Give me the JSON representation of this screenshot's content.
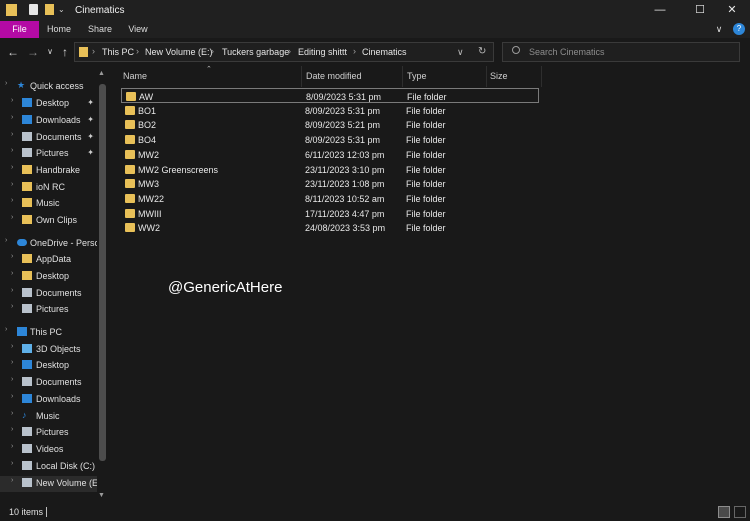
{
  "window": {
    "title": "Cinematics",
    "minimize": "—",
    "maximize": "☐",
    "close": "✕"
  },
  "ribbon": {
    "tabs": [
      "File",
      "Home",
      "Share",
      "View"
    ],
    "expand": "∨",
    "help": "?"
  },
  "nav": {
    "back": "←",
    "forward": "→",
    "recent": "∨",
    "up": "↑",
    "refresh": "↻",
    "breadcrumbs": [
      "This PC",
      "New Volume (E:)",
      "Tuckers garbage",
      "Editing shittt",
      "Cinematics"
    ],
    "dropdown": "∨",
    "search_placeholder": "Search Cinematics"
  },
  "navpane": {
    "items": [
      {
        "label": "Quick access",
        "icon": "star-icon",
        "level": 0,
        "pinned": false
      },
      {
        "label": "Desktop",
        "icon": "desktop-icon",
        "level": 1,
        "pinned": true
      },
      {
        "label": "Downloads",
        "icon": "downloads-icon",
        "level": 1,
        "pinned": true
      },
      {
        "label": "Documents",
        "icon": "documents-icon",
        "level": 1,
        "pinned": true
      },
      {
        "label": "Pictures",
        "icon": "pictures-icon",
        "level": 1,
        "pinned": true
      },
      {
        "label": "Handbrake",
        "icon": "folder-icon",
        "level": 1,
        "pinned": false
      },
      {
        "label": "ioN RC",
        "icon": "folder-icon",
        "level": 1,
        "pinned": false
      },
      {
        "label": "Music",
        "icon": "folder-icon",
        "level": 1,
        "pinned": false
      },
      {
        "label": "Own Clips",
        "icon": "folder-icon",
        "level": 1,
        "pinned": false
      },
      {
        "label": "OneDrive - Persor",
        "icon": "cloud-icon",
        "level": 0,
        "pinned": false
      },
      {
        "label": "AppData",
        "icon": "folder-icon",
        "level": 1,
        "pinned": false
      },
      {
        "label": "Desktop",
        "icon": "folder-icon",
        "level": 1,
        "pinned": false
      },
      {
        "label": "Documents",
        "icon": "documents-icon",
        "level": 1,
        "pinned": false
      },
      {
        "label": "Pictures",
        "icon": "pictures-icon",
        "level": 1,
        "pinned": false
      },
      {
        "label": "This PC",
        "icon": "pc-icon",
        "level": 0,
        "pinned": false
      },
      {
        "label": "3D Objects",
        "icon": "cube-icon",
        "level": 1,
        "pinned": false
      },
      {
        "label": "Desktop",
        "icon": "desktop-icon",
        "level": 1,
        "pinned": false
      },
      {
        "label": "Documents",
        "icon": "documents-icon",
        "level": 1,
        "pinned": false
      },
      {
        "label": "Downloads",
        "icon": "downloads-icon",
        "level": 1,
        "pinned": false
      },
      {
        "label": "Music",
        "icon": "music-icon",
        "level": 1,
        "pinned": false
      },
      {
        "label": "Pictures",
        "icon": "pictures-icon",
        "level": 1,
        "pinned": false
      },
      {
        "label": "Videos",
        "icon": "videos-icon",
        "level": 1,
        "pinned": false
      },
      {
        "label": "Local Disk (C:)",
        "icon": "drive-icon",
        "level": 1,
        "pinned": false
      },
      {
        "label": "New Volume (E:)",
        "icon": "drive-icon",
        "level": 1,
        "pinned": false
      }
    ]
  },
  "columns": {
    "name": "Name",
    "date": "Date modified",
    "type": "Type",
    "size": "Size"
  },
  "files": [
    {
      "name": "AW",
      "date": "8/09/2023 5:31 pm",
      "type": "File folder"
    },
    {
      "name": "BO1",
      "date": "8/09/2023 5:31 pm",
      "type": "File folder"
    },
    {
      "name": "BO2",
      "date": "8/09/2023 5:21 pm",
      "type": "File folder"
    },
    {
      "name": "BO4",
      "date": "8/09/2023 5:31 pm",
      "type": "File folder"
    },
    {
      "name": "MW2",
      "date": "6/11/2023 12:03 pm",
      "type": "File folder"
    },
    {
      "name": "MW2 Greenscreens",
      "date": "23/11/2023 3:10 pm",
      "type": "File folder"
    },
    {
      "name": "MW3",
      "date": "23/11/2023 1:08 pm",
      "type": "File folder"
    },
    {
      "name": "MW22",
      "date": "8/11/2023 10:52 am",
      "type": "File folder"
    },
    {
      "name": "MWIII",
      "date": "17/11/2023 4:47 pm",
      "type": "File folder"
    },
    {
      "name": "WW2",
      "date": "24/08/2023 3:53 pm",
      "type": "File folder"
    }
  ],
  "watermark": "@GenericAtHere",
  "status": {
    "item_count": "10 items"
  }
}
